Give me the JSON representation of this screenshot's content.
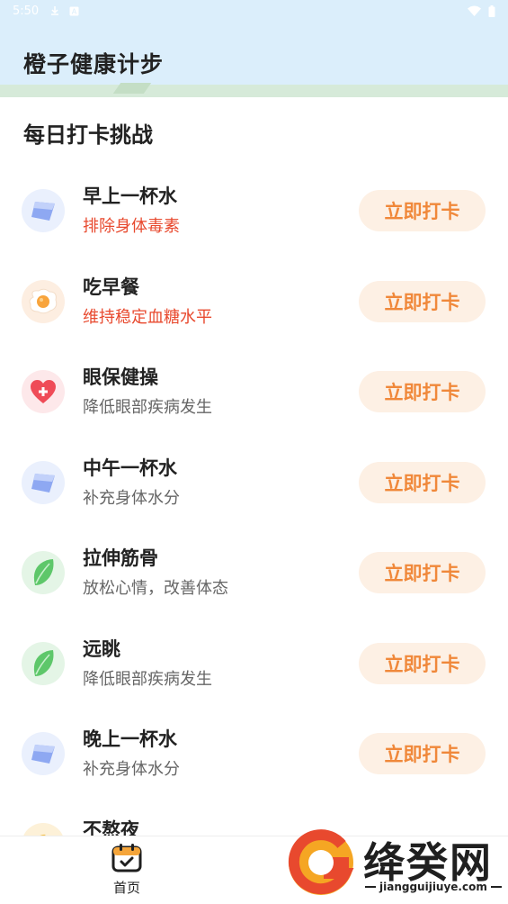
{
  "status_bar": {
    "time": "5:50"
  },
  "header": {
    "title": "橙子健康计步"
  },
  "section": {
    "title": "每日打卡挑战"
  },
  "tasks": [
    {
      "title": "早上一杯水",
      "subtitle": "排除身体毒素",
      "button": "立即打卡",
      "icon": "water-icon",
      "subtitle_color": "#e8492e"
    },
    {
      "title": "吃早餐",
      "subtitle": "维持稳定血糖水平",
      "button": "立即打卡",
      "icon": "egg-icon",
      "subtitle_color": "#e8492e"
    },
    {
      "title": "眼保健操",
      "subtitle": "降低眼部疾病发生",
      "button": "立即打卡",
      "icon": "heart-icon"
    },
    {
      "title": "中午一杯水",
      "subtitle": "补充身体水分",
      "button": "立即打卡",
      "icon": "water-icon"
    },
    {
      "title": "拉伸筋骨",
      "subtitle": "放松心情，改善体态",
      "button": "立即打卡",
      "icon": "leaf-icon"
    },
    {
      "title": "远眺",
      "subtitle": "降低眼部疾病发生",
      "button": "立即打卡",
      "icon": "leaf-icon"
    },
    {
      "title": "晚上一杯水",
      "subtitle": "补充身体水分",
      "button": "立即打卡",
      "icon": "water-icon"
    },
    {
      "title": "不熬夜",
      "subtitle": "",
      "button": "",
      "icon": "moon-icon"
    }
  ],
  "bottom_nav": {
    "home_label": "首页"
  },
  "watermark": {
    "text": "绛癸网",
    "url": "jiangguijiuye.com"
  },
  "colors": {
    "accent": "#f0883a",
    "button_bg": "#fdf0e4",
    "header_bg": "#dbeefb",
    "warning": "#e8492e"
  }
}
